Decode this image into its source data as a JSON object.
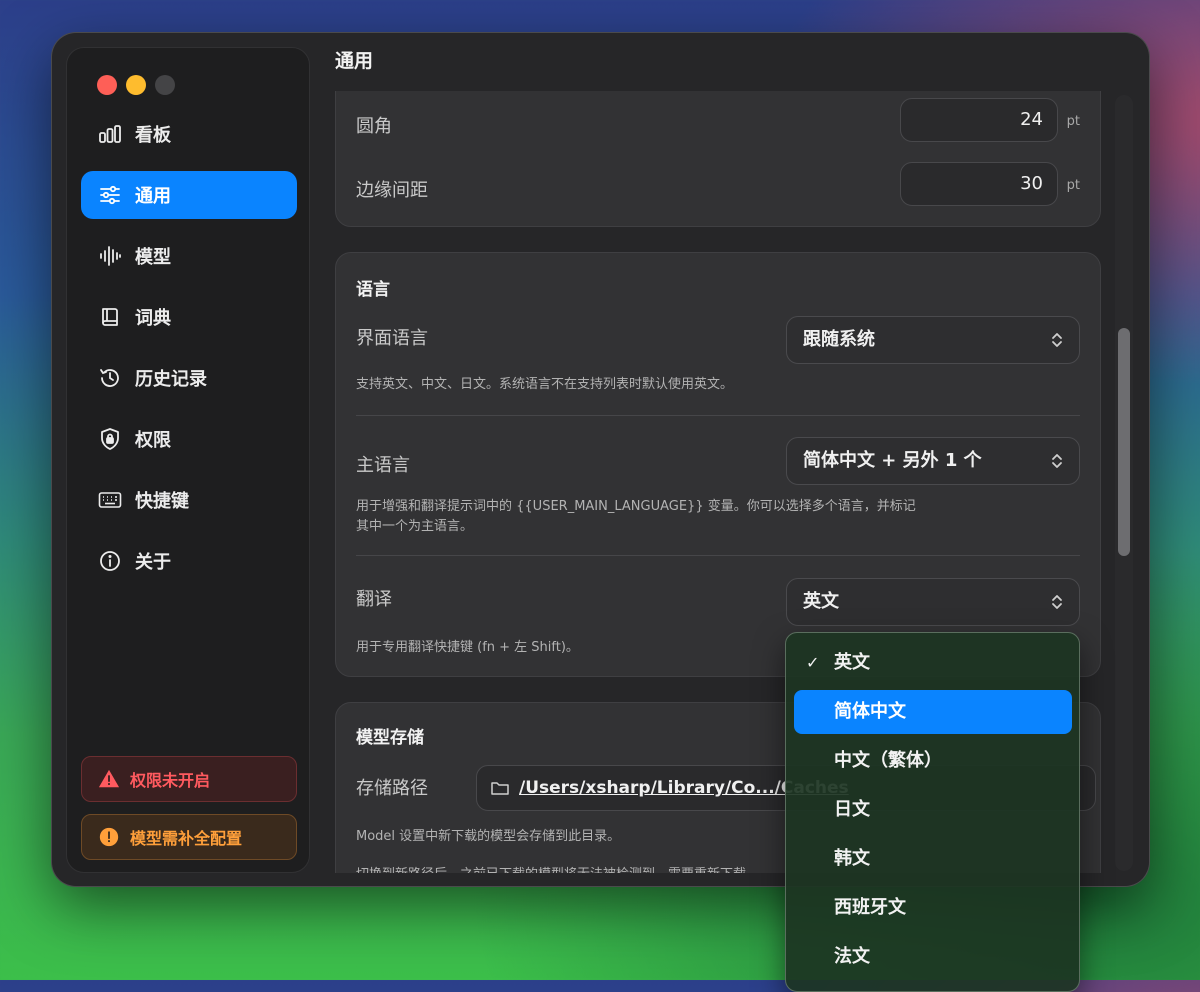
{
  "window": {
    "controls": [
      "close",
      "minimize",
      "zoom"
    ]
  },
  "sidebar": {
    "items": [
      {
        "label": "看板",
        "icon": "dashboard-bars-icon"
      },
      {
        "label": "通用",
        "icon": "sliders-icon",
        "active": true
      },
      {
        "label": "模型",
        "icon": "waveform-icon"
      },
      {
        "label": "词典",
        "icon": "book-icon"
      },
      {
        "label": "历史记录",
        "icon": "history-clock-icon"
      },
      {
        "label": "权限",
        "icon": "lock-shield-icon"
      },
      {
        "label": "快捷键",
        "icon": "keyboard-icon"
      },
      {
        "label": "关于",
        "icon": "info-icon"
      }
    ],
    "alerts": [
      {
        "label": "权限未开启",
        "icon": "warning-triangle-icon",
        "color": "#ff5a5f"
      },
      {
        "label": "模型需补全配置",
        "icon": "exclamation-circle-icon",
        "color": "#ff9f3a"
      }
    ]
  },
  "main": {
    "title": "通用",
    "appearance": {
      "corner_radius": {
        "label": "圆角",
        "value": "24",
        "unit": "pt"
      },
      "edge_spacing": {
        "label": "边缘间距",
        "value": "30",
        "unit": "pt"
      }
    },
    "language": {
      "title": "语言",
      "ui_language": {
        "label": "界面语言",
        "value": "跟随系统",
        "help": "支持英文、中文、日文。系统语言不在支持列表时默认使用英文。"
      },
      "main_language": {
        "label": "主语言",
        "value": "简体中文 + 另外 1 个",
        "help_line1": "用于增强和翻译提示词中的 {{USER_MAIN_LANGUAGE}} 变量。你可以选择多个语言，并标记",
        "help_line2": "其中一个为主语言。"
      },
      "translation": {
        "label": "翻译",
        "value": "英文",
        "help": "用于专用翻译快捷键 (fn + 左 Shift)。"
      }
    },
    "model_storage": {
      "title": "模型存储",
      "path_label": "存储路径",
      "path_value": "/Users/xsharp/Library/Co.../Caches",
      "help1": "Model 设置中新下载的模型会存储到此目录。",
      "help2": "切换到新路径后，之前已下载的模型将无法被检测到，需要重新下载。"
    }
  },
  "dropdown": {
    "options": [
      "英文",
      "简体中文",
      "中文（繁体）",
      "日文",
      "韩文",
      "西班牙文",
      "法文"
    ],
    "checked": "英文",
    "highlighted": "简体中文",
    "check_glyph": "✓"
  },
  "colors": {
    "accent": "#0a84ff",
    "window_bg": "#262628",
    "card_bg": "#323234"
  }
}
